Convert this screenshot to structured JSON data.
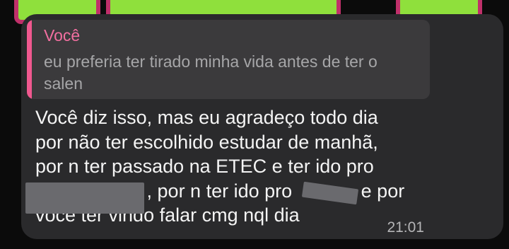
{
  "chat": {
    "reply": {
      "author": "Você",
      "text": "eu preferia ter tirado minha vida antes de ter o salen"
    },
    "message": {
      "lines": [
        "Você diz isso, mas eu agradeço todo dia",
        "por não ter escolhido estudar de manhã,",
        "por n ter passado na ETEC e ter ido pro",
        "                     , por n ter ido pro             e por",
        "você ter vindo falar cmg nql dia"
      ]
    },
    "timestamp": "21:01"
  },
  "colors": {
    "background": "#0b0b0b",
    "bubble": "#2a2a2c",
    "reply_bg": "#3b3a3c",
    "reply_accent": "#f0588f",
    "author": "#f26fa0",
    "text": "#f4f4f4",
    "muted": "#a6a6a8"
  }
}
